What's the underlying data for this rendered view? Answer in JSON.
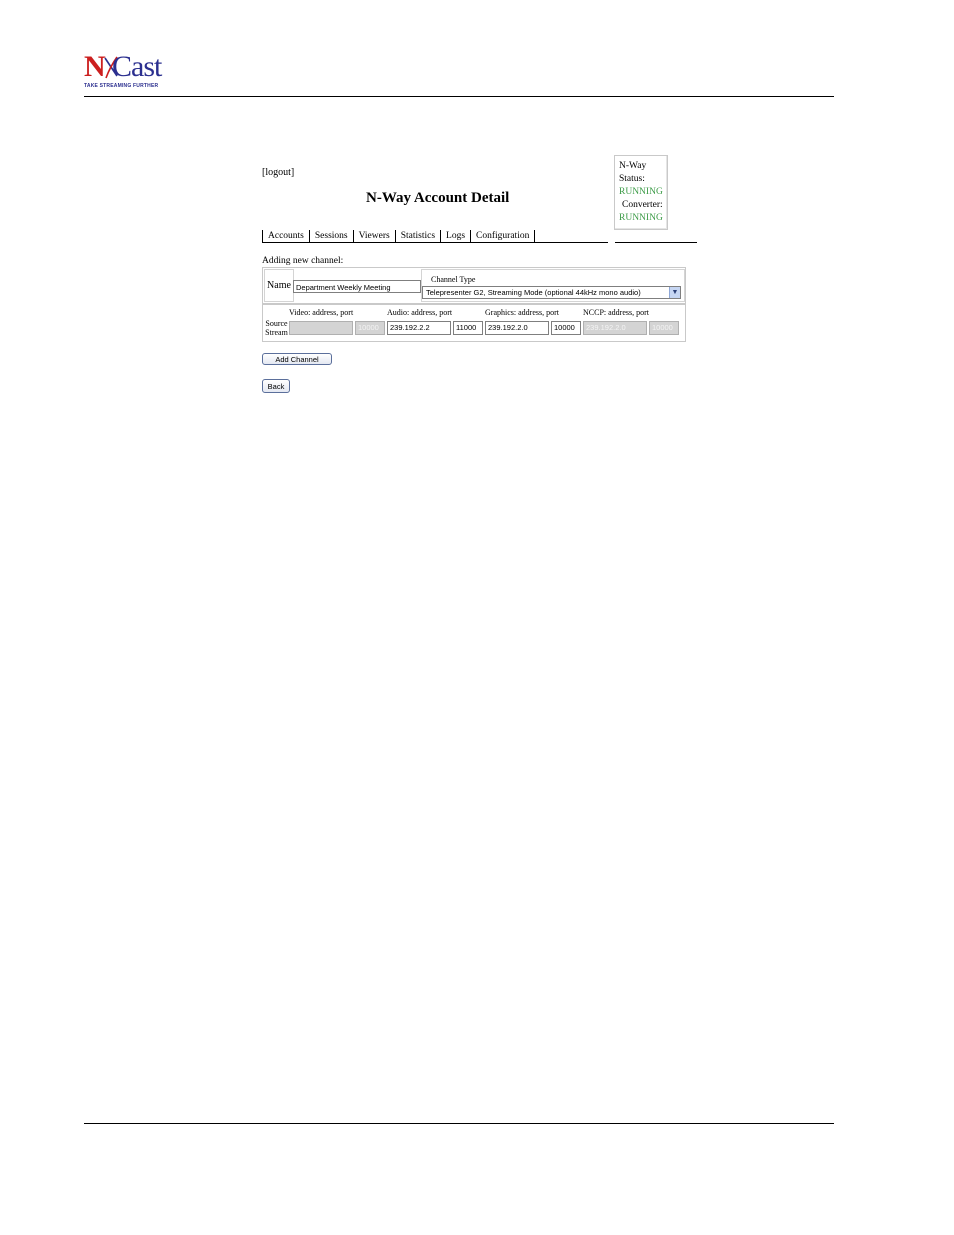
{
  "brand": {
    "logo_n": "N",
    "logo_cast": "Cast",
    "tagline": "TAKE STREAMING FURTHER"
  },
  "colors": {
    "logo_red": "#cc1f1f",
    "logo_blue": "#2b2f8f",
    "running_green": "#3a9a45"
  },
  "page": {
    "logout": "[logout]",
    "title": "N-Way Account Detail"
  },
  "status": {
    "nway_label_1": "N-Way",
    "nway_label_2": "Status:",
    "nway_status": "RUNNING",
    "converter_label": "Converter:",
    "converter_status": "RUNNING"
  },
  "tabs": [
    "Accounts",
    "Sessions",
    "Viewers",
    "Statistics",
    "Logs",
    "Configuration"
  ],
  "form": {
    "adding_label": "Adding new channel:",
    "name_label": "Name",
    "name_value": "Department Weekly Meeting",
    "channel_type_label": "Channel Type",
    "channel_type_value": "Telepresenter G2, Streaming Mode (optional 44kHz mono audio)",
    "source_stream_label_1": "Source",
    "source_stream_label_2": "Stream",
    "headers": {
      "video": "Video: address, port",
      "audio": "Audio: address, port",
      "graphics": "Graphics: address, port",
      "nccp": "NCCP: address, port"
    },
    "video_address": "",
    "video_port": "10000",
    "audio_address": "239.192.2.2",
    "audio_port": "11000",
    "graphics_address": "239.192.2.0",
    "graphics_port": "10000",
    "nccp_address": "239.192.2.0",
    "nccp_port": "10000",
    "add_channel_button": "Add Channel",
    "back_button": "Back"
  }
}
